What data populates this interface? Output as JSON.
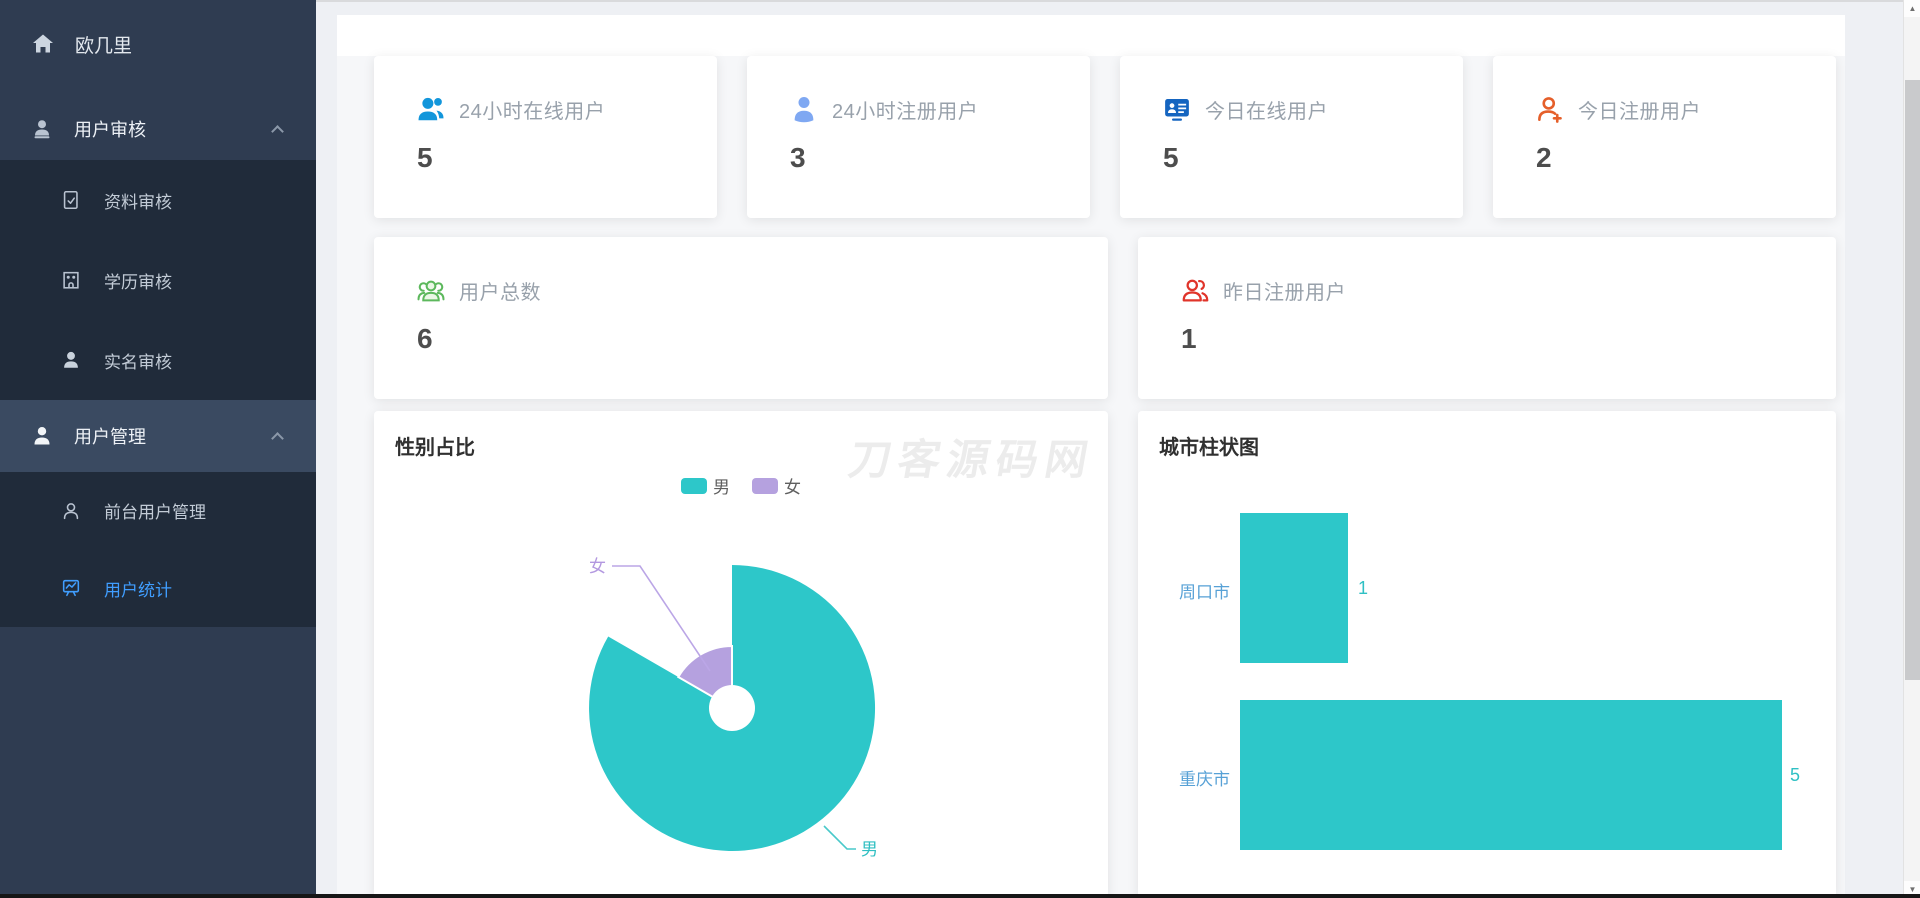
{
  "sidebar": {
    "logo": {
      "label": "欧几里",
      "icon": "home-icon"
    },
    "items": [
      {
        "label": "用户审核",
        "icon": "user-audit-icon",
        "type": "parent",
        "expanded": true
      },
      {
        "label": "资料审核",
        "icon": "document-check-icon"
      },
      {
        "label": "学历审核",
        "icon": "school-building-icon"
      },
      {
        "label": "实名审核",
        "icon": "person-icon"
      },
      {
        "label": "用户管理",
        "icon": "user-icon",
        "type": "parent",
        "expanded": true
      },
      {
        "label": "前台用户管理",
        "icon": "person-outline-icon"
      },
      {
        "label": "用户统计",
        "icon": "chart-board-icon",
        "active": true,
        "active_color": "#409eff"
      }
    ]
  },
  "stats": [
    {
      "label": "24小时在线用户",
      "value": "5",
      "icon": "users-icon",
      "icon_color": "#1296db"
    },
    {
      "label": "24小时注册用户",
      "value": "3",
      "icon": "user-icon",
      "icon_color": "#7fa8f2"
    },
    {
      "label": "今日在线用户",
      "value": "5",
      "icon": "id-card-icon",
      "icon_color": "#1565c0"
    },
    {
      "label": "今日注册用户",
      "value": "2",
      "icon": "user-plus-icon",
      "icon_color": "#e55f2a"
    },
    {
      "label": "用户总数",
      "value": "6",
      "icon": "user-group-icon",
      "icon_color": "#5cb85c"
    },
    {
      "label": "昨日注册用户",
      "value": "1",
      "icon": "users-outline-icon",
      "icon_color": "#e0342a"
    }
  ],
  "pie_chart": {
    "title": "性别占比",
    "legend": [
      {
        "label": "男",
        "color": "#2dc7c9"
      },
      {
        "label": "女",
        "color": "#b5a1df"
      }
    ],
    "callouts": {
      "male": "男",
      "female": "女"
    }
  },
  "bar_chart": {
    "title": "城市柱状图",
    "rows": [
      {
        "category": "周口市",
        "value": "1"
      },
      {
        "category": "重庆市",
        "value": "5"
      }
    ]
  },
  "watermark": "刀客源码网",
  "scrollbar": {
    "up_arrow": "▲",
    "down_arrow": "▼"
  },
  "chart_data": [
    {
      "type": "pie",
      "title": "性别占比",
      "style": "rose",
      "legend_position": "top-center",
      "legend": [
        "男",
        "女"
      ],
      "slices": [
        {
          "name": "男",
          "value": 5,
          "color": "#2dc7c9"
        },
        {
          "name": "女",
          "value": 1,
          "color": "#b5a1df"
        }
      ]
    },
    {
      "type": "bar",
      "title": "城市柱状图",
      "orientation": "horizontal",
      "categories": [
        "周口市",
        "重庆市"
      ],
      "values": [
        1,
        5
      ],
      "bar_color": "#2dc7c9",
      "xlim": [
        0,
        5
      ],
      "grid": false,
      "value_labels": true
    }
  ]
}
